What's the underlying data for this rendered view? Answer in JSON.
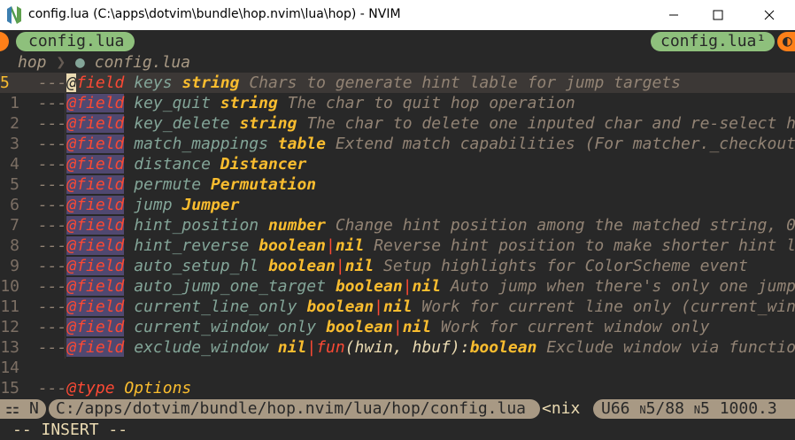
{
  "window": {
    "title": "config.lua (C:\\apps\\dotvim\\bundle\\hop.nvim\\lua\\hop) - NVIM",
    "icon": "neovim-icon",
    "minimize_glyph": "—",
    "maximize_glyph": "☐",
    "close_glyph": "✕"
  },
  "tabline": {
    "left_tab": "config.lua",
    "right_tab": "config.lua¹"
  },
  "breadcrumb": {
    "folder": "hop",
    "separator": "❯",
    "file_icon": "lua-icon",
    "file": "config.lua"
  },
  "code": {
    "lines": [
      {
        "num": "5",
        "current": true,
        "prefix": "---",
        "tag": "@field",
        "name": "keys",
        "type": "string",
        "desc": "Chars to generate hint lable for jump targets"
      },
      {
        "num": "1",
        "prefix": "---",
        "tag": "@field",
        "name": "key_quit",
        "type": "string",
        "desc": "The char to quit hop operation"
      },
      {
        "num": "2",
        "prefix": "---",
        "tag": "@field",
        "name": "key_delete",
        "type": "string",
        "desc": "The char to delete one inputed char and re-select h"
      },
      {
        "num": "3",
        "prefix": "---",
        "tag": "@field",
        "name": "match_mappings",
        "type": "table",
        "desc": "Extend match capabilities (For matcher._checkout"
      },
      {
        "num": "4",
        "prefix": "---",
        "tag": "@field",
        "name": "distance",
        "type": "Distancer",
        "desc": ""
      },
      {
        "num": "5",
        "prefix": "---",
        "tag": "@field",
        "name": "permute",
        "type": "Permutation",
        "desc": ""
      },
      {
        "num": "6",
        "prefix": "---",
        "tag": "@field",
        "name": "jump",
        "type": "Jumper",
        "desc": ""
      },
      {
        "num": "7",
        "prefix": "---",
        "tag": "@field",
        "name": "hint_position",
        "type": "number",
        "desc": "Change hint position among the matched string, 0"
      },
      {
        "num": "8",
        "prefix": "---",
        "tag": "@field",
        "name": "hint_reverse",
        "type": "boolean",
        "type2": "nil",
        "desc": "Reverse hint position to make shorter hint l"
      },
      {
        "num": "9",
        "prefix": "---",
        "tag": "@field",
        "name": "auto_setup_hl",
        "type": "boolean",
        "type2": "nil",
        "desc": "Setup highlights for ColorScheme event"
      },
      {
        "num": "10",
        "prefix": "---",
        "tag": "@field",
        "name": "auto_jump_one_target",
        "type": "boolean",
        "type2": "nil",
        "desc": "Auto jump when there's only one jump"
      },
      {
        "num": "11",
        "prefix": "---",
        "tag": "@field",
        "name": "current_line_only",
        "type": "boolean",
        "type2": "nil",
        "desc": "Work for current line only (current_win"
      },
      {
        "num": "12",
        "prefix": "---",
        "tag": "@field",
        "name": "current_window_only",
        "type": "boolean",
        "type2": "nil",
        "desc": "Work for current window only"
      },
      {
        "num": "13",
        "prefix": "---",
        "tag": "@field",
        "name": "exclude_window",
        "type": "nil",
        "type2": "fun",
        "params": "(hwin, hbuf):",
        "ret": "boolean",
        "desc": "Exclude window via functio"
      },
      {
        "num": "14",
        "empty": true
      },
      {
        "num": "15",
        "prefix": "---",
        "tag": "@type",
        "name": "Options",
        "type": "",
        "desc": ""
      }
    ]
  },
  "statusline": {
    "mode_icon": "⚏",
    "mode": "N",
    "path": "C:/apps/dotvim/bundle/hop.nvim/lua/hop/config.lua",
    "fileformat": "<nix",
    "encoding": "U66",
    "position_mark": "N",
    "position": "5/88",
    "col_mark": "N",
    "col": "5 1000.3"
  },
  "cmdline": {
    "text": "-- INSERT --"
  },
  "colors": {
    "background": "#282828",
    "accent_green": "#8ec07c",
    "accent_orange": "#fe8019",
    "status_gray": "#a89984"
  }
}
